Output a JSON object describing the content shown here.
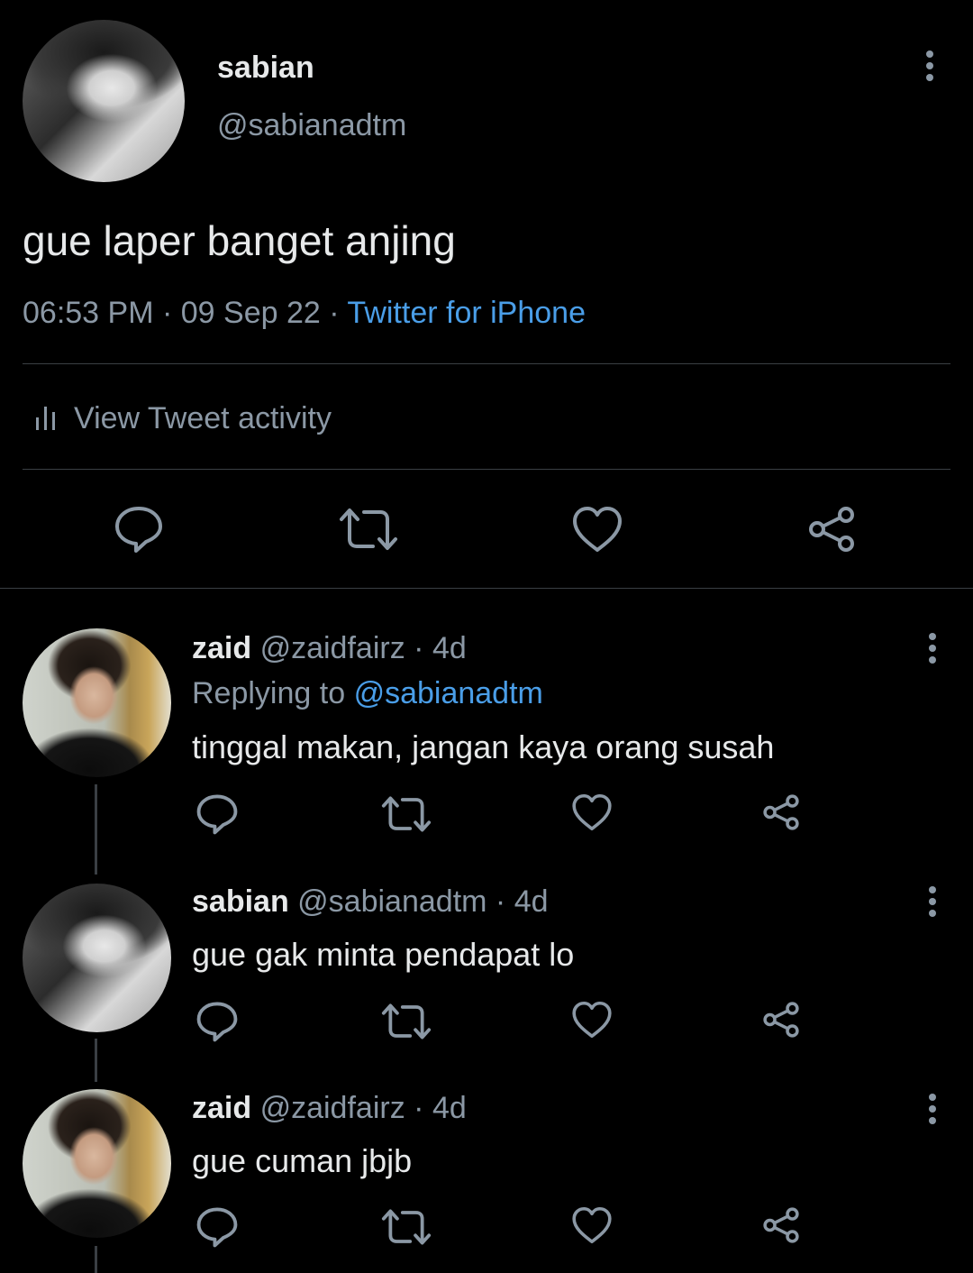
{
  "main_tweet": {
    "display_name": "sabian",
    "handle": "@sabianadtm",
    "text": "gue laper banget anjing",
    "time": "06:53 PM",
    "date": "09 Sep 22",
    "separator": "·",
    "source": "Twitter for iPhone",
    "activity_label": "View Tweet activity"
  },
  "replies": [
    {
      "display_name": "zaid",
      "handle": "@zaidfairz",
      "age": "4d",
      "separator": "·",
      "replying_prefix": "Replying to",
      "replying_handle": "@sabianadtm",
      "text": "tinggal makan, jangan kaya orang susah"
    },
    {
      "display_name": "sabian",
      "handle": "@sabianadtm",
      "age": "4d",
      "separator": "·",
      "text": "gue gak minta pendapat lo"
    },
    {
      "display_name": "zaid",
      "handle": "@zaidfairz",
      "age": "4d",
      "separator": "·",
      "text": "gue cuman jbjb"
    }
  ],
  "colors": {
    "background": "#000000",
    "text": "#e7e9ea",
    "secondary": "#8b98a5",
    "link": "#4a9ee8",
    "divider": "#3a3f44"
  },
  "icons": [
    "more-icon",
    "reply-icon",
    "retweet-icon",
    "like-icon",
    "share-icon",
    "activity-icon"
  ]
}
